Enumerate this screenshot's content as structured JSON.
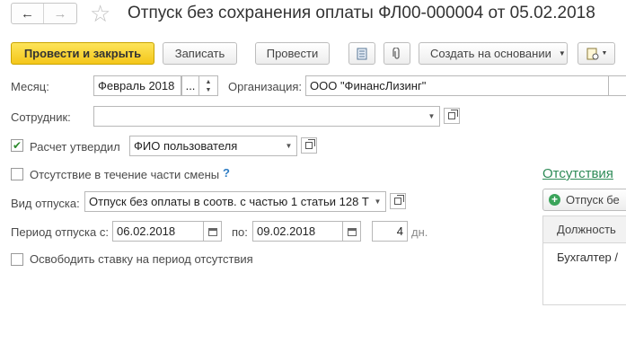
{
  "header": {
    "back_icon": "arrow-left-icon",
    "forward_icon": "arrow-right-icon",
    "favorite_icon": "star-icon",
    "title": "Отпуск без сохранения оплаты ФЛ00-000004 от 05.02.2018"
  },
  "toolbar": {
    "post_close": "Провести и закрыть",
    "save": "Записать",
    "post": "Провести",
    "based_on": "Создать на основании",
    "report_icon": "document-list-icon",
    "attach_icon": "paperclip-icon",
    "print_icon": "print-icon"
  },
  "form": {
    "month_label": "Месяц:",
    "month_value": "Февраль 2018",
    "org_label": "Организация:",
    "org_value": "ООО \"ФинансЛизинг\"",
    "employee_label": "Сотрудник:",
    "employee_value": "",
    "approved_label": "Расчет утвердил",
    "approved_checked": true,
    "approved_value": "ФИО пользователя",
    "partial_shift_label": "Отсутствие в течение части смены",
    "partial_shift_help": "?",
    "leave_type_label": "Вид отпуска:",
    "leave_type_value": "Отпуск без оплаты в соотв. с частью 1 статьи 128 Т",
    "period_from_label": "Период отпуска с:",
    "period_from_value": "06.02.2018",
    "period_to_label": "по:",
    "period_to_value": "09.02.2018",
    "days_value": "4",
    "days_unit": "дн.",
    "release_rate_label": "Освободить ставку на период отсутствия"
  },
  "side_panel": {
    "link": "Отсутствия",
    "add_button": "Отпуск бе",
    "column_header": "Должность",
    "row_value": "Бухгалтер /"
  }
}
